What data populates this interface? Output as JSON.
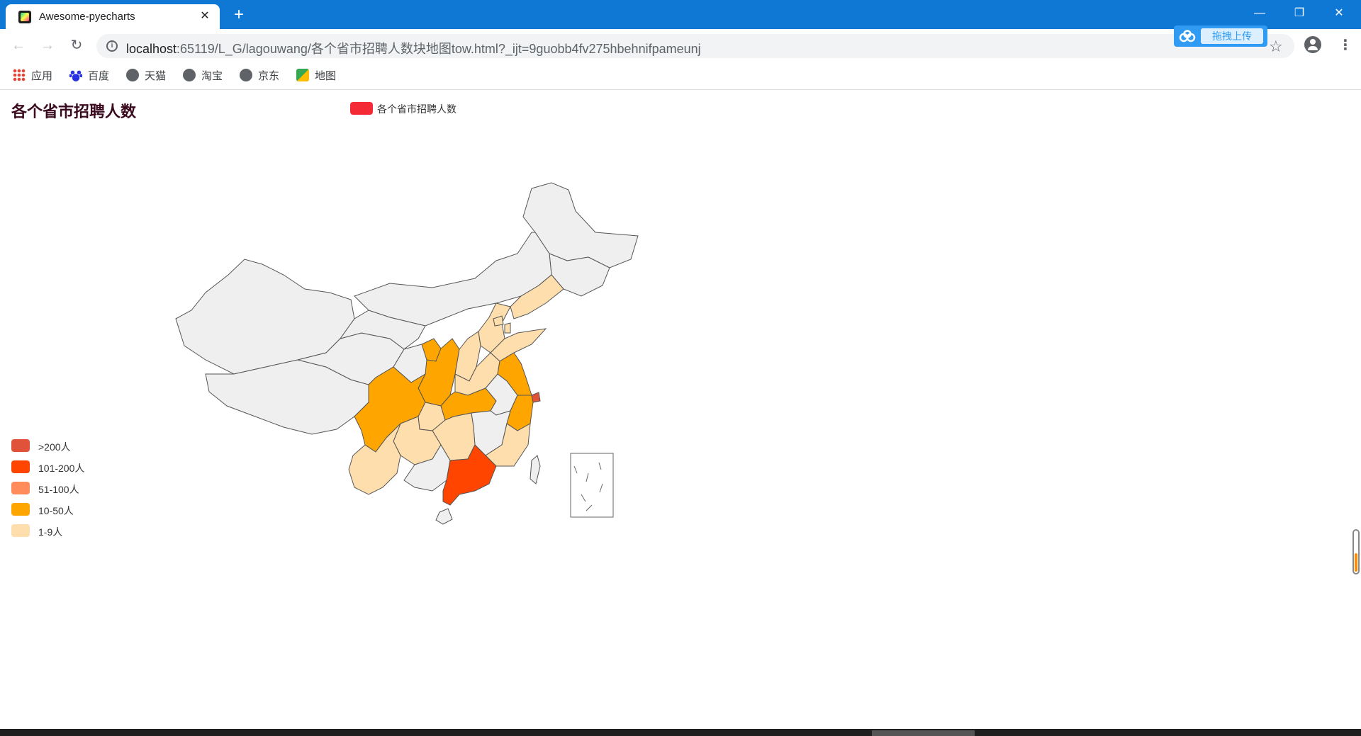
{
  "browser": {
    "tab_title": "Awesome-pyecharts",
    "url_host": "localhost",
    "url_path": ":65119/L_G/lagouwang/各个省市招聘人数块地图tow.html?_ijt=9guobb4fv275hbehnifpameunj",
    "upload_label": "拖拽上传",
    "win_minimize": "—",
    "win_restore": "❐",
    "win_close": "✕",
    "close_tab_glyph": "✕",
    "new_tab_glyph": "+",
    "back_glyph": "←",
    "forward_glyph": "→",
    "reload_glyph": "↻",
    "star_glyph": "☆",
    "menu_glyph": "⋮",
    "info_glyph": "i"
  },
  "bookmarks": [
    {
      "label": "应用",
      "icon": "apps-grid-icon"
    },
    {
      "label": "百度",
      "icon": "baidu-paw-icon"
    },
    {
      "label": "天猫",
      "icon": "globe-icon"
    },
    {
      "label": "淘宝",
      "icon": "globe-icon"
    },
    {
      "label": "京东",
      "icon": "globe-icon"
    },
    {
      "label": "地图",
      "icon": "maps-pin-icon"
    }
  ],
  "chart": {
    "title": "各个省市招聘人数",
    "legend_series": "各个省市招聘人数",
    "series_color": "#f42a36"
  },
  "chart_data": {
    "type": "map",
    "title": "各个省市招聘人数",
    "series": [
      {
        "name": "各个省市招聘人数"
      }
    ],
    "visual_map_pieces": [
      {
        "label": ">200人",
        "color": "#e0533a"
      },
      {
        "label": "101-200人",
        "color": "#ff4500"
      },
      {
        "label": "51-100人",
        "color": "#ff8c5a"
      },
      {
        "label": "10-50人",
        "color": "#ffa500"
      },
      {
        "label": "1-9人",
        "color": "#ffdead"
      }
    ],
    "default_color": "#efefef",
    "regions": [
      {
        "name": "广东",
        "bucket": "101-200人"
      },
      {
        "name": "上海",
        "bucket": ">200人"
      },
      {
        "name": "四川",
        "bucket": "10-50人"
      },
      {
        "name": "陕西",
        "bucket": "10-50人"
      },
      {
        "name": "宁夏",
        "bucket": "10-50人"
      },
      {
        "name": "湖北",
        "bucket": "10-50人"
      },
      {
        "name": "江苏",
        "bucket": "10-50人"
      },
      {
        "name": "浙江",
        "bucket": "10-50人"
      },
      {
        "name": "云南",
        "bucket": "1-9人"
      },
      {
        "name": "贵州",
        "bucket": "1-9人"
      },
      {
        "name": "重庆",
        "bucket": "1-9人"
      },
      {
        "name": "湖南",
        "bucket": "1-9人"
      },
      {
        "name": "河南",
        "bucket": "1-9人"
      },
      {
        "name": "山西",
        "bucket": "1-9人"
      },
      {
        "name": "河北",
        "bucket": "1-9人"
      },
      {
        "name": "北京",
        "bucket": "1-9人"
      },
      {
        "name": "天津",
        "bucket": "1-9人"
      },
      {
        "name": "辽宁",
        "bucket": "1-9人"
      },
      {
        "name": "山东",
        "bucket": "1-9人"
      },
      {
        "name": "福建",
        "bucket": "1-9人"
      }
    ]
  }
}
